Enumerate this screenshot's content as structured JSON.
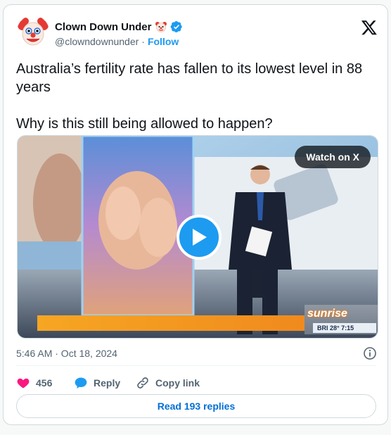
{
  "author": {
    "name": "Clown Down Under",
    "handle": "@clowndownunder",
    "separator": "·",
    "follow_label": "Follow"
  },
  "tweet": {
    "text": "Australia’s fertility rate has fallen to its lowest level in 88 years\n\nWhy is this still being allowed to happen?",
    "timestamp": "5:46 AM · Oct 18, 2024"
  },
  "media": {
    "watch_label": "Watch on X",
    "channel_logo": "sunrise",
    "ticker_text": "BRI 28°  7:15"
  },
  "actions": {
    "likes_count": "456",
    "reply_label": "Reply",
    "copy_link_label": "Copy link"
  },
  "read_replies_label": "Read 193 replies",
  "colors": {
    "accent": "#1d9bf0",
    "like": "#f91880",
    "text_secondary": "#536471"
  },
  "icons": [
    "clown-emoji-icon",
    "verified-icon",
    "x-logo-icon",
    "play-icon",
    "info-icon",
    "heart-icon",
    "reply-bubble-icon",
    "link-icon"
  ]
}
